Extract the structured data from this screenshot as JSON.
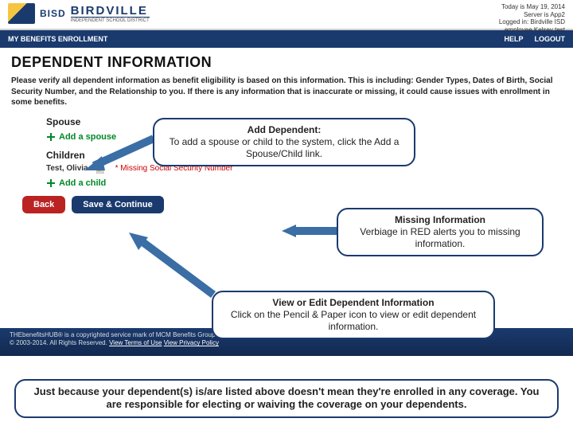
{
  "header": {
    "bisd_small": "BISD",
    "brand": "BIRDVILLE",
    "brand_sub": "INDEPENDENT SCHOOL DISTRICT",
    "meta_line1": "Today is May 19, 2014",
    "meta_line2": "Server is App2",
    "meta_line3": "Logged in: Birdville ISD",
    "meta_line4": "employee Kelsey test"
  },
  "nav": {
    "left": "MY BENEFITS ENROLLMENT",
    "help": "HELP",
    "logout": "LOGOUT"
  },
  "page": {
    "title": "DEPENDENT INFORMATION",
    "instructions": "Please verify all dependent information as benefit eligibility is based on this information. This is including: Gender Types, Dates of Birth, Social Security Number, and the Relationship to you. If there is any information that is inaccurate or missing, it could cause issues with enrollment in some benefits.",
    "spouse_label": "Spouse",
    "add_spouse": "Add a spouse",
    "children_label": "Children",
    "child_name": "Test, Olivia",
    "missing_ssn": "* Missing Social Security Number",
    "add_child": "Add a child"
  },
  "buttons": {
    "back": "Back",
    "save": "Save & Continue"
  },
  "footer": {
    "line1": "THEbenefitsHUB® is a copyrighted service mark of MCM Benefits Group.",
    "line2_prefix": "© 2003-2014. All Rights Reserved.",
    "tou": "View Terms of Use",
    "privacy": "View Privacy Policy"
  },
  "callouts": {
    "c1_title": "Add Dependent:",
    "c1_body": "To add a spouse or child to the system, click the Add a Spouse/Child link.",
    "c2_title": "Missing Information",
    "c2_body": "Verbiage in RED alerts you to missing information.",
    "c3_title": "View or Edit Dependent Information",
    "c3_body": "Click on the Pencil & Paper icon to view or edit dependent information.",
    "note": "Just because your dependent(s) is/are listed above doesn't mean they're enrolled in any coverage. You are responsible for electing or waiving the coverage on your dependents."
  }
}
